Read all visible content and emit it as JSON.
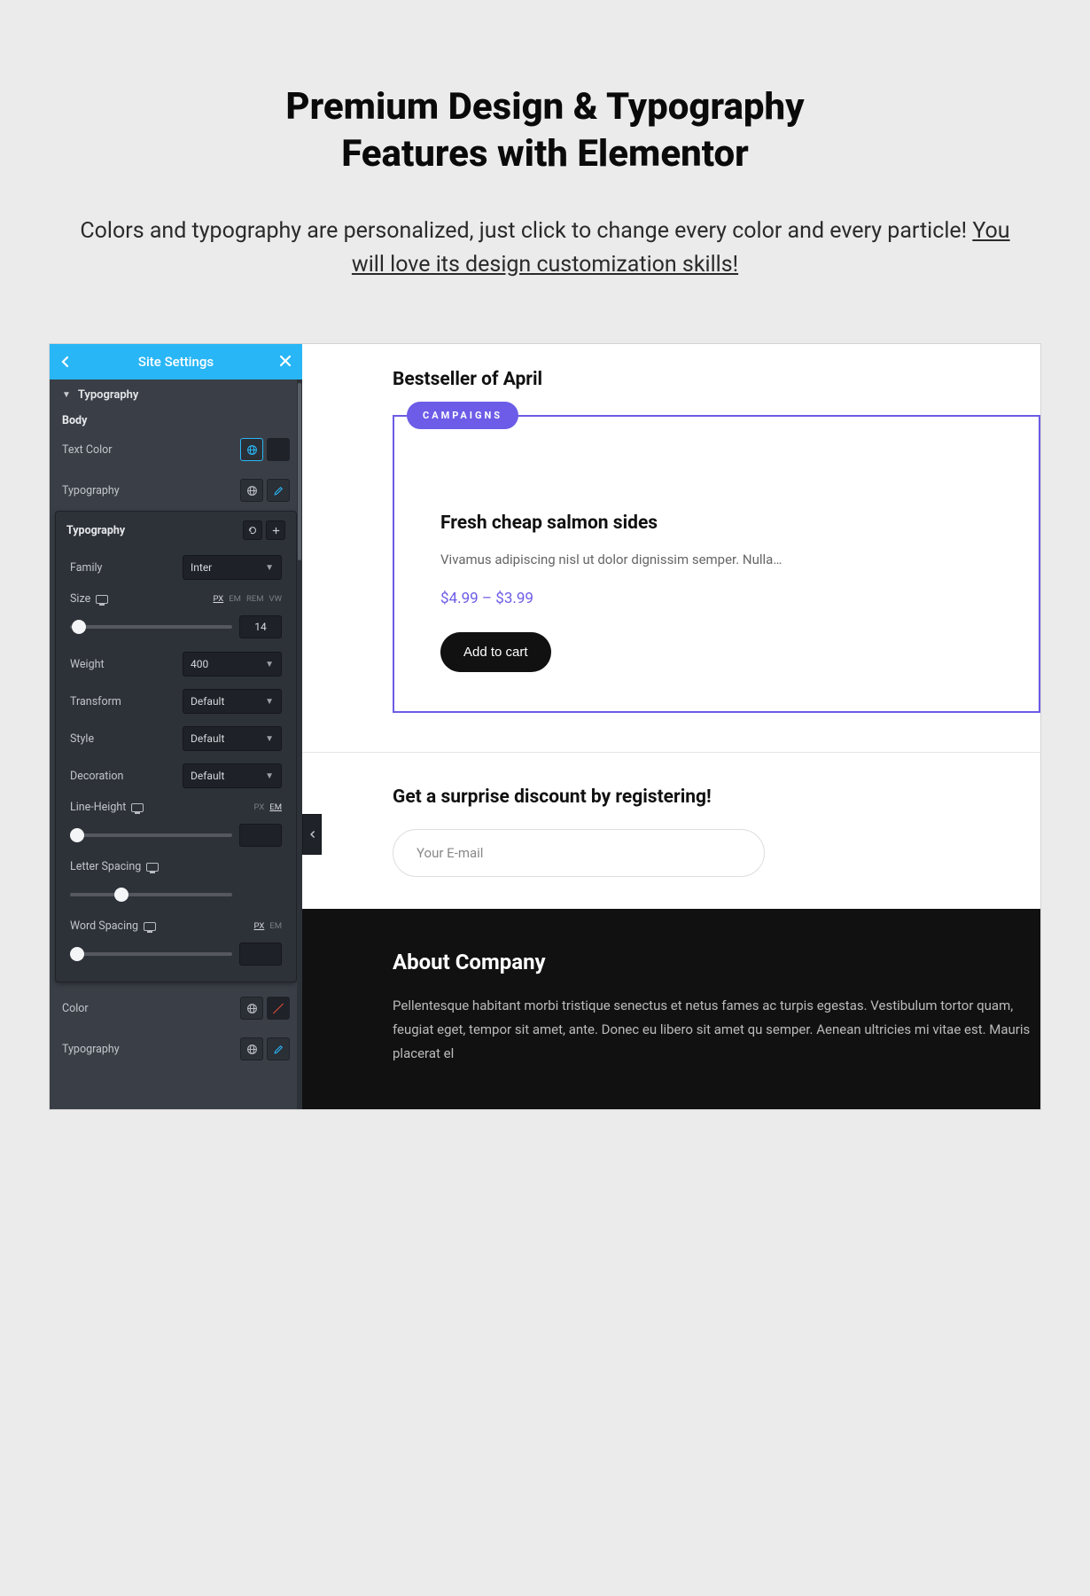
{
  "hero": {
    "title_line1": "Premium Design & Typography",
    "title_line2": "Features with Elementor",
    "desc_part1": "Colors and typography are personalized, just click to change every color and every particle! ",
    "desc_underline": "You will love its design customization skills!"
  },
  "sidebar": {
    "title": "Site Settings",
    "section": "Typography",
    "body_label": "Body",
    "text_color_label": "Text Color",
    "typography_label": "Typography",
    "typo_block": {
      "title": "Typography",
      "family_label": "Family",
      "family_value": "Inter",
      "size_label": "Size",
      "size_units_active": "PX",
      "size_unit_em": "EM",
      "size_unit_rem": "REM",
      "size_unit_vw": "VW",
      "size_value": "14",
      "weight_label": "Weight",
      "weight_value": "400",
      "transform_label": "Transform",
      "transform_value": "Default",
      "style_label": "Style",
      "style_value": "Default",
      "decoration_label": "Decoration",
      "decoration_value": "Default",
      "line_height_label": "Line-Height",
      "line_height_unit_px": "PX",
      "line_height_unit_em": "EM",
      "letter_spacing_label": "Letter Spacing",
      "word_spacing_label": "Word Spacing",
      "word_spacing_unit_px": "PX",
      "word_spacing_unit_em": "EM"
    },
    "color_label": "Color",
    "typography2_label": "Typography"
  },
  "preview": {
    "heading": "Bestseller of April",
    "badge": "CAMPAIGNS",
    "card_title": "Fresh cheap salmon sides",
    "card_desc": "Vivamus adipiscing nisl ut dolor dignissim semper. Nulla…",
    "price": "$4.99 – $3.99",
    "cart_btn": "Add to cart",
    "surprise_heading": "Get a surprise discount by registering!",
    "email_placeholder": "Your E-mail",
    "footer_heading": "About Company",
    "footer_text": "Pellentesque habitant morbi tristique senectus et netus fames ac turpis egestas. Vestibulum tortor quam, feugiat eget, tempor sit amet, ante. Donec eu libero sit amet qu semper. Aenean ultricies mi vitae est. Mauris placerat el"
  }
}
